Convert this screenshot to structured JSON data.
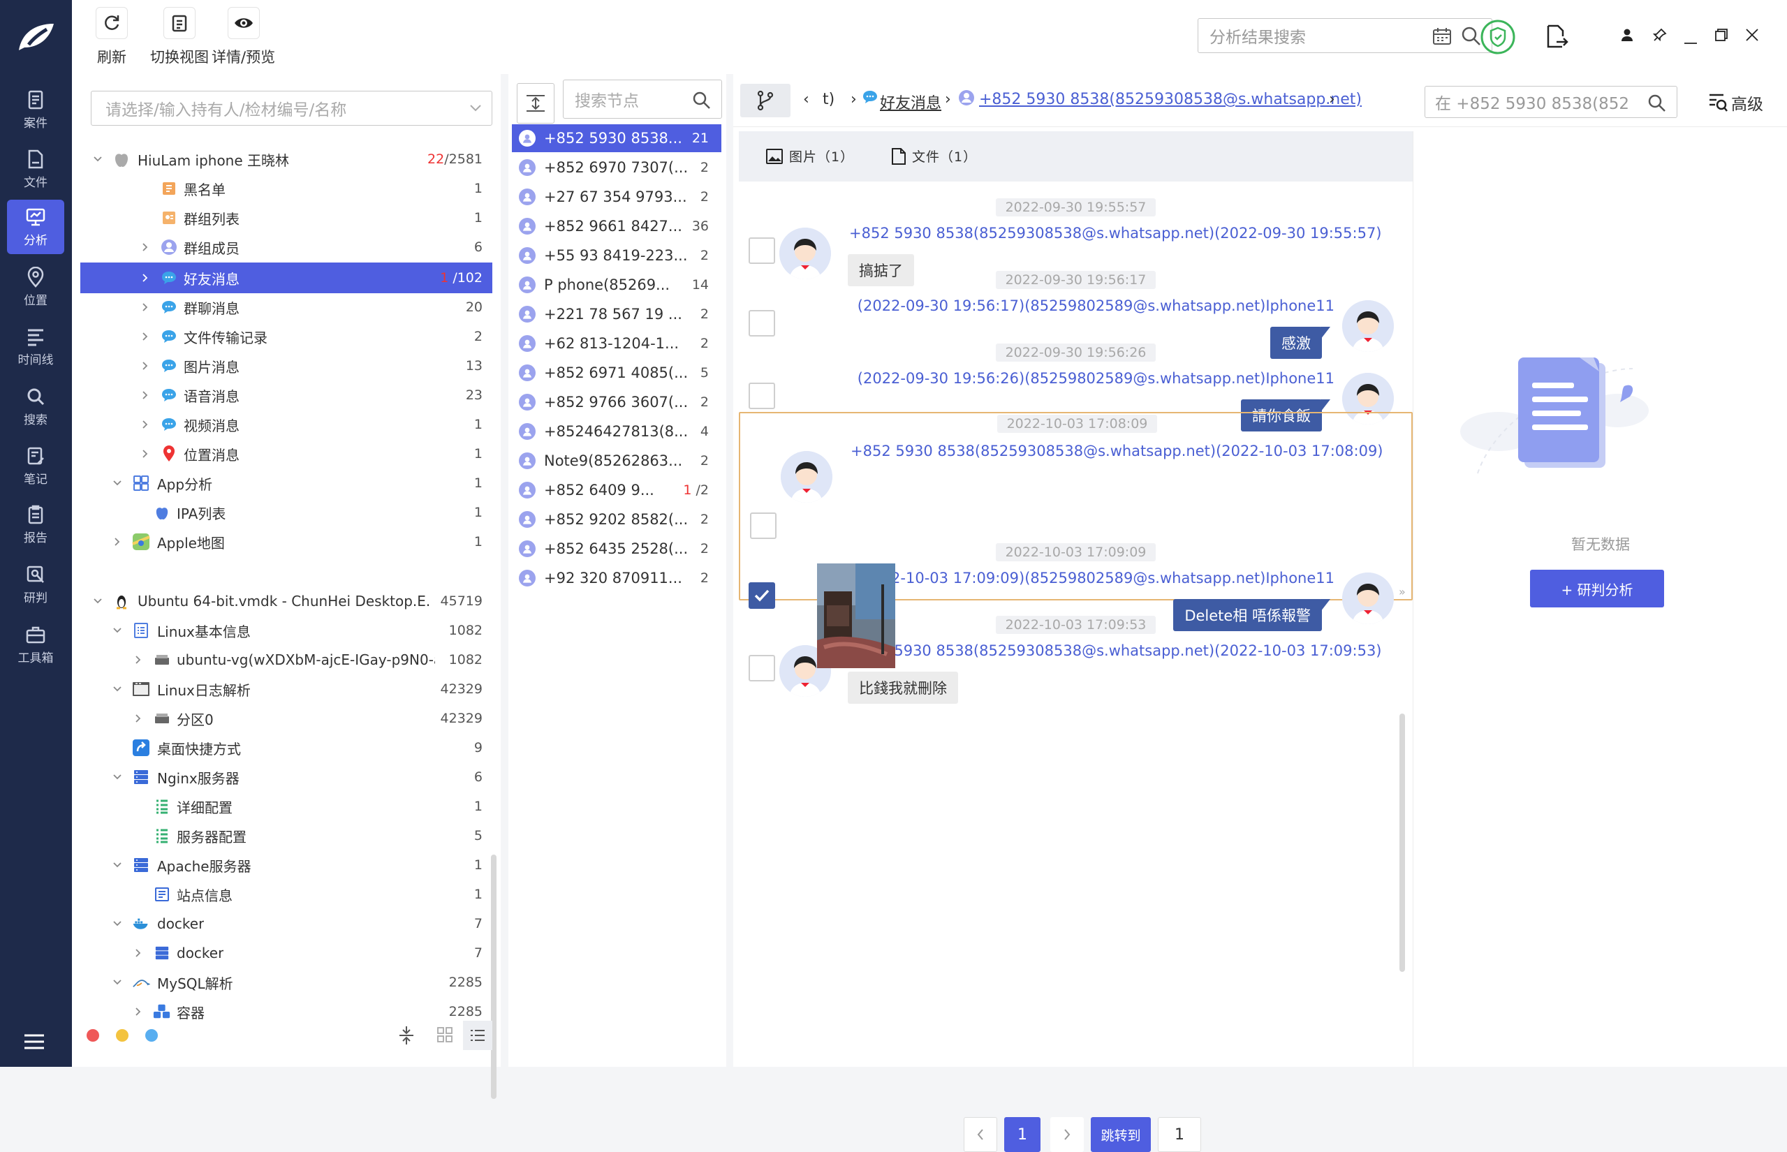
{
  "nav": {
    "items": [
      {
        "label": "案件",
        "icon": "case-icon"
      },
      {
        "label": "文件",
        "icon": "file-icon"
      },
      {
        "label": "分析",
        "icon": "analysis-icon",
        "active": true
      },
      {
        "label": "位置",
        "icon": "location-icon"
      },
      {
        "label": "时间线",
        "icon": "timeline-icon"
      },
      {
        "label": "搜索",
        "icon": "search-icon"
      },
      {
        "label": "笔记",
        "icon": "notes-icon"
      },
      {
        "label": "报告",
        "icon": "report-icon"
      },
      {
        "label": "研判",
        "icon": "judgment-icon"
      },
      {
        "label": "工具箱",
        "icon": "toolbox-icon"
      }
    ]
  },
  "toolbar": {
    "refresh": "刷新",
    "switch_view": "切换视图",
    "details": "详情/预览",
    "search_placeholder": "分析结果搜索"
  },
  "tree": {
    "select_placeholder": "请选择/输入持有人/检材编号/名称",
    "rows": [
      {
        "label": "HiuLam iphone 王晓林",
        "count_red": "22",
        "count": "/2581"
      },
      {
        "label": "黑名单",
        "count": "1"
      },
      {
        "label": "群组列表",
        "count": "1"
      },
      {
        "label": "群组成员",
        "count": "6"
      },
      {
        "label": "好友消息",
        "count_red": "1",
        "count": " /102"
      },
      {
        "label": "群聊消息",
        "count": "20"
      },
      {
        "label": "文件传输记录",
        "count": "2"
      },
      {
        "label": "图片消息",
        "count": "13"
      },
      {
        "label": "语音消息",
        "count": "23"
      },
      {
        "label": "视频消息",
        "count": "1"
      },
      {
        "label": "位置消息",
        "count": "1"
      },
      {
        "label": "App分析",
        "count": "1"
      },
      {
        "label": "IPA列表",
        "count": "1"
      },
      {
        "label": "Apple地图",
        "count": "1"
      },
      {
        "label": "Ubuntu 64-bit.vmdk - ChunHei Desktop.E...",
        "count": "45719"
      },
      {
        "label": "Linux基本信息",
        "count": "1082"
      },
      {
        "label": "ubuntu-vg(wXDXbM-ajcE-IGay-p9N0-a...",
        "count": "1082"
      },
      {
        "label": "Linux日志解析",
        "count": "42329"
      },
      {
        "label": "分区0",
        "count": "42329"
      },
      {
        "label": "桌面快捷方式",
        "count": "9"
      },
      {
        "label": "Nginx服务器",
        "count": "6"
      },
      {
        "label": "详细配置",
        "count": "1"
      },
      {
        "label": "服务器配置",
        "count": "5"
      },
      {
        "label": "Apache服务器",
        "count": "1"
      },
      {
        "label": "站点信息",
        "count": "1"
      },
      {
        "label": "docker",
        "count": "7"
      },
      {
        "label": "docker",
        "count": "7"
      },
      {
        "label": "MySQL解析",
        "count": "2285"
      },
      {
        "label": "容器",
        "count": "2285"
      }
    ]
  },
  "nodes": {
    "search_placeholder": "搜索节点",
    "rows": [
      {
        "label": "+852 5930 8538...",
        "count": "21"
      },
      {
        "label": "+852 6970 7307(...",
        "count": "2"
      },
      {
        "label": "+27 67 354 9793...",
        "count": "2"
      },
      {
        "label": "+852 9661 8427...",
        "count": "36"
      },
      {
        "label": "+55 93 8419-223...",
        "count": "2"
      },
      {
        "label": "P phone(85269...",
        "count": "14"
      },
      {
        "label": "+221 78 567 19 ...",
        "count": "2"
      },
      {
        "label": "+62 813-1204-1...",
        "count": "2"
      },
      {
        "label": "+852 6971 4085(...",
        "count": "5"
      },
      {
        "label": "+852 9766 3607(...",
        "count": "2"
      },
      {
        "label": "+85246427813(8...",
        "count": "4"
      },
      {
        "label": "Note9(85262863...",
        "count": "2"
      },
      {
        "label": "+852 6409 9...",
        "count_red": "1",
        "count": " /2"
      },
      {
        "label": "+852 9202 8582(...",
        "count": "2"
      },
      {
        "label": "+852 6435 2528(...",
        "count": "2"
      },
      {
        "label": "+92 320 870911...",
        "count": "2"
      }
    ]
  },
  "chat": {
    "breadcrumb_t": "t)",
    "breadcrumb_category": "好友消息",
    "breadcrumb_contact": "+852 5930 8538(85259308538@s.whatsapp.net)",
    "search_placeholder": "在 +852 5930 8538(852",
    "advanced": "高级",
    "tab_images": "图片（1）",
    "tab_files": "文件（1）",
    "messages": [
      {
        "time": "2022-09-30 19:55:57",
        "sender": "+852 5930 8538(85259308538@s.whatsapp.net)(2022-09-30 19:55:57)",
        "text": "搞掂了",
        "dir": "in",
        "checked": false
      },
      {
        "time": "2022-09-30 19:56:17",
        "sender": "(2022-09-30 19:56:17)(85259802589@s.whatsapp.net)Iphone11",
        "text": "感激",
        "dir": "out",
        "checked": false
      },
      {
        "time": "2022-09-30 19:56:26",
        "sender": "(2022-09-30 19:56:26)(85259802589@s.whatsapp.net)Iphone11",
        "text": "請你食飯",
        "dir": "out",
        "checked": false
      },
      {
        "time": "2022-10-03 17:08:09",
        "sender": "+852 5930 8538(85259308538@s.whatsapp.net)(2022-10-03 17:08:09)",
        "text": "",
        "dir": "in",
        "checked": false
      },
      {
        "time": "2022-10-03 17:09:09",
        "sender": "(2022-10-03 17:09:09)(85259802589@s.whatsapp.net)Iphone11",
        "text": "Delete相 唔係報警",
        "dir": "out",
        "checked": true
      },
      {
        "time": "2022-10-03 17:09:53",
        "sender": "+852 5930 8538(85259308538@s.whatsapp.net)(2022-10-03 17:09:53)",
        "text": "比錢我就刪除",
        "dir": "in",
        "checked": false
      }
    ],
    "pager": {
      "current": "1",
      "jump_label": "跳转到",
      "jump_value": "1"
    }
  },
  "side": {
    "empty_text": "暂无数据",
    "analyze_button": "+ 研判分析"
  }
}
